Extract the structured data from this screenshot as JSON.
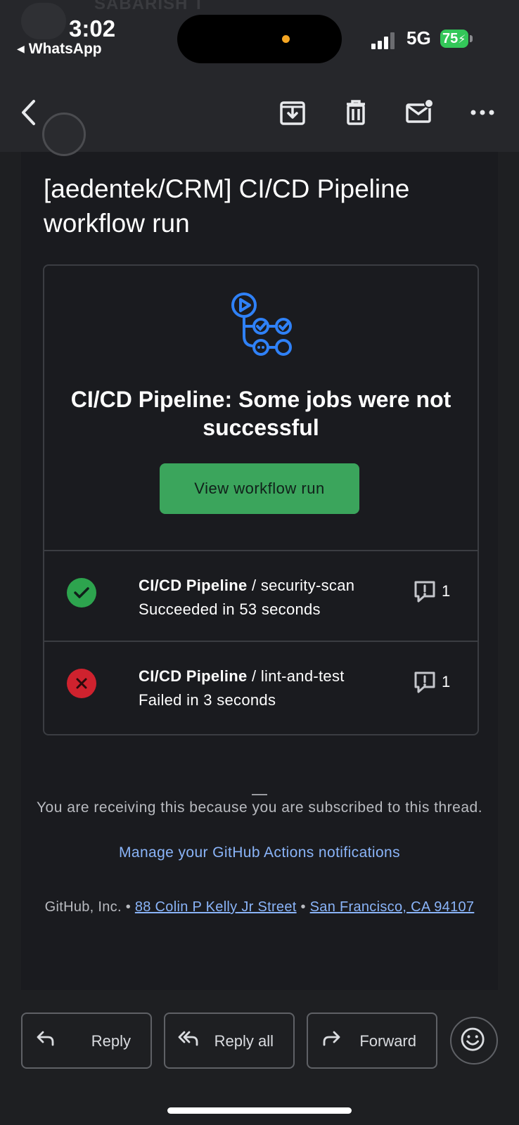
{
  "status_bar": {
    "time": "3:02",
    "back_app": "WhatsApp",
    "network": "5G",
    "battery": "75"
  },
  "ghost_notification": {
    "sender": "SABARISH T"
  },
  "toolbar": {
    "back_icon": "back-arrow-icon",
    "archive_icon": "archive-icon",
    "delete_icon": "trash-icon",
    "mark_unread_icon": "mail-unread-icon",
    "more_icon": "more-horizontal-icon"
  },
  "email": {
    "subject": "[aedentek/CRM] CI/CD Pipeline workflow run",
    "headline": "CI/CD Pipeline: Some jobs were not successful",
    "cta_label": "View workflow run",
    "jobs": [
      {
        "workflow": "CI/CD Pipeline",
        "separator": " / ",
        "job": "security-scan",
        "status_text": "Succeeded in 53 seconds",
        "status": "success",
        "comments": "1"
      },
      {
        "workflow": "CI/CD Pipeline",
        "separator": " / ",
        "job": "lint-and-test",
        "status_text": "Failed in 3 seconds",
        "status": "failure",
        "comments": "1"
      }
    ],
    "footer": {
      "dash": "—",
      "receiving": "You are receiving this because you are subscribed to this thread.",
      "manage_link": "Manage your GitHub Actions notifications",
      "company": "GitHub, Inc.",
      "bullet": " • ",
      "street": "88 Colin P Kelly Jr Street",
      "city": "San Francisco, CA 94107"
    }
  },
  "actions": {
    "reply": "Reply",
    "reply_all": "Reply all",
    "forward": "Forward",
    "emoji_icon": "emoji-reaction-icon"
  },
  "colors": {
    "success": "#2da44e",
    "failure": "#cf222e",
    "cta": "#3ba55c",
    "link": "#8ab4f8"
  }
}
